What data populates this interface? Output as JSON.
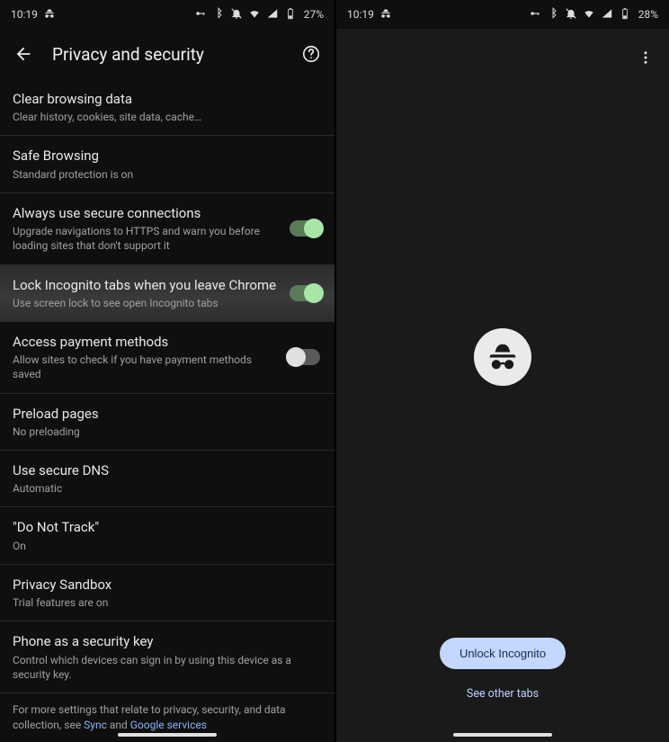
{
  "left": {
    "status": {
      "time": "10:19",
      "battery_text": "27%"
    },
    "header": {
      "title": "Privacy and security"
    },
    "rows": {
      "clear": {
        "title": "Clear browsing data",
        "sub": "Clear history, cookies, site data, cache…"
      },
      "safe": {
        "title": "Safe Browsing",
        "sub": "Standard protection is on"
      },
      "secure": {
        "title": "Always use secure connections",
        "sub": "Upgrade navigations to HTTPS and warn you before loading sites that don't support it"
      },
      "lock": {
        "title": "Lock Incognito tabs when you leave Chrome",
        "sub": "Use screen lock to see open Incognito tabs"
      },
      "payment": {
        "title": "Access payment methods",
        "sub": "Allow sites to check if you have payment methods saved"
      },
      "preload": {
        "title": "Preload pages",
        "sub": "No preloading"
      },
      "dns": {
        "title": "Use secure DNS",
        "sub": "Automatic"
      },
      "dnt": {
        "title": "\"Do Not Track\"",
        "sub": "On"
      },
      "sandbox": {
        "title": "Privacy Sandbox",
        "sub": "Trial features are on"
      },
      "phonekey": {
        "title": "Phone as a security key",
        "sub": "Control which devices can sign in by using this device as a security key."
      }
    },
    "footer": {
      "pre": "For more settings that relate to privacy, security, and data collection, see ",
      "link1": "Sync",
      "mid": " and ",
      "link2": "Google services"
    }
  },
  "right": {
    "status": {
      "time": "10:19",
      "battery_text": "28%"
    },
    "unlock_label": "Unlock Incognito",
    "see_other_label": "See other tabs"
  }
}
